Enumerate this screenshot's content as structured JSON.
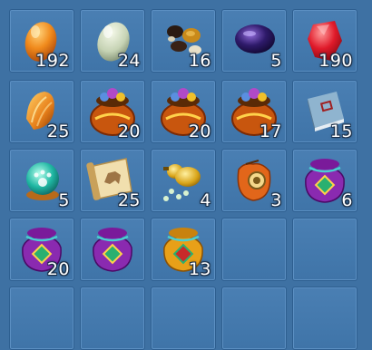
{
  "inventory": {
    "slots": [
      {
        "item": "orange-egg",
        "count": "192"
      },
      {
        "item": "pale-green-egg",
        "count": "24"
      },
      {
        "item": "nuts-and-seeds",
        "count": "16"
      },
      {
        "item": "dark-purple-gem",
        "count": "5"
      },
      {
        "item": "red-gem",
        "count": "190"
      },
      {
        "item": "amber-seashell",
        "count": "25"
      },
      {
        "item": "treasure-pot",
        "count": "20"
      },
      {
        "item": "treasure-pot",
        "count": "20"
      },
      {
        "item": "treasure-pot",
        "count": "17"
      },
      {
        "item": "blue-book",
        "count": "15"
      },
      {
        "item": "pet-paw-orb",
        "count": "5"
      },
      {
        "item": "horse-scroll",
        "count": "25"
      },
      {
        "item": "gourd-and-pearls",
        "count": "4"
      },
      {
        "item": "orange-pouch-with-coin",
        "count": "3"
      },
      {
        "item": "purple-gift-bag",
        "count": "6"
      },
      {
        "item": "purple-gift-bag",
        "count": "20"
      },
      {
        "item": "purple-gift-bag",
        "count": ""
      },
      {
        "item": "golden-gift-bag",
        "count": "13"
      },
      {
        "item": "",
        "count": ""
      },
      {
        "item": "",
        "count": ""
      }
    ]
  }
}
